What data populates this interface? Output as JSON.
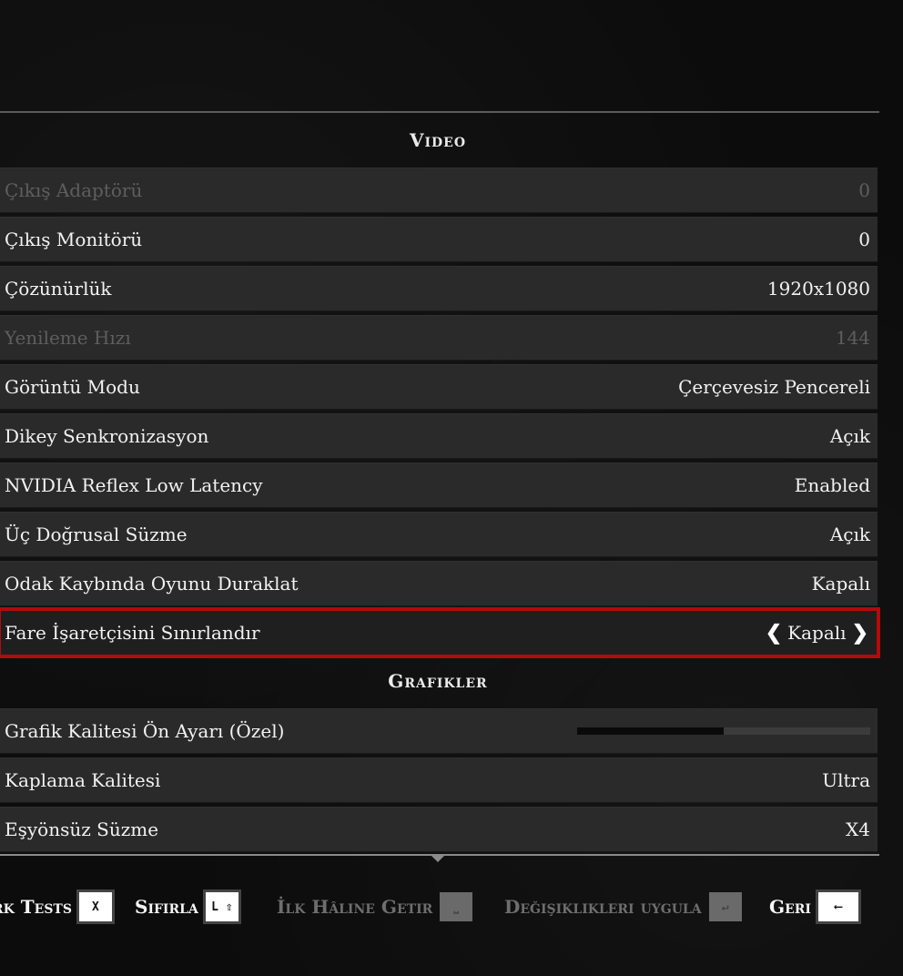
{
  "sections": {
    "video": "Video",
    "graphics": "Grafikler"
  },
  "rows": [
    {
      "label": "Çıkış Adaptörü",
      "value": "0",
      "state": "disabled"
    },
    {
      "label": "Çıkış Monitörü",
      "value": "0",
      "state": "normal"
    },
    {
      "label": "Çözünürlük",
      "value": "1920x1080",
      "state": "normal"
    },
    {
      "label": "Yenileme Hızı",
      "value": "144",
      "state": "disabled"
    },
    {
      "label": "Görüntü Modu",
      "value": "Çerçevesiz Pencereli",
      "state": "normal"
    },
    {
      "label": "Dikey Senkronizasyon",
      "value": "Açık",
      "state": "normal"
    },
    {
      "label": "NVIDIA Reflex Low Latency",
      "value": "Enabled",
      "state": "normal"
    },
    {
      "label": "Üç Doğrusal Süzme",
      "value": "Açık",
      "state": "normal"
    },
    {
      "label": "Odak Kaybında Oyunu Duraklat",
      "value": "Kapalı",
      "state": "normal"
    },
    {
      "label": "Fare İşaretçisini Sınırlandır",
      "value": "Kapalı",
      "state": "selected"
    }
  ],
  "graphics_rows": [
    {
      "label": "Grafik Kalitesi Ön Ayarı  (Özel)",
      "slider_fraction": 0.5
    },
    {
      "label": "Kaplama Kalitesi",
      "value": "Ultra"
    },
    {
      "label": "Eşyönsüz Süzme",
      "value": "X4"
    }
  ],
  "arrows": {
    "left": "❮",
    "right": "❯"
  },
  "footer": {
    "benchmark": {
      "label": "rk Tests",
      "key": "X"
    },
    "reset": {
      "label": "Sıfırla",
      "key": "L ⇧"
    },
    "restore": {
      "label": "İlk Hâline Getir",
      "key": "⎵"
    },
    "apply": {
      "label": "Değişiklikleri uygula",
      "key": "↵"
    },
    "back": {
      "label": "Geri",
      "key": "⟵"
    }
  },
  "colors": {
    "accent": "#b30a0a",
    "background": "#0c0c0c",
    "row": "#2a2a2a"
  }
}
